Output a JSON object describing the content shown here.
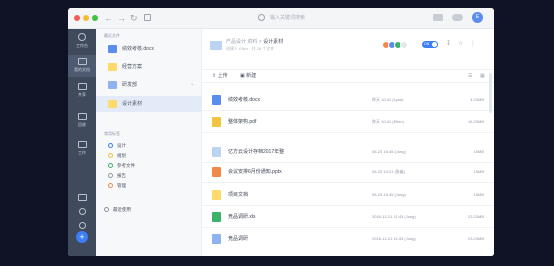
{
  "colors": {
    "accent": "#3d7ef5",
    "rail": "#3f4a5c",
    "folder": "#ffd96a",
    "word": "#5b8def",
    "pdf": "#f0c43f",
    "ppt": "#f08a4b",
    "excel": "#3bb36a",
    "image": "#8fb2f2"
  },
  "search": {
    "placeholder": "输入关键词搜索"
  },
  "user": {
    "initial": "E"
  },
  "rail": {
    "items": [
      {
        "label": "工作台",
        "icon": "dashboard-icon"
      },
      {
        "label": "我的文档",
        "icon": "doc-icon"
      },
      {
        "label": "共享",
        "icon": "share-icon"
      },
      {
        "label": "回收",
        "icon": "trash-icon"
      },
      {
        "label": "工作",
        "icon": "work-icon"
      }
    ]
  },
  "panel": {
    "section_recent": "最近文件",
    "items": [
      {
        "label": "绩效考核.docx",
        "icon": "word-icon"
      },
      {
        "label": "经营方案",
        "icon": "folder-icon"
      },
      {
        "label": "研发部",
        "icon": "team-icon"
      },
      {
        "label": "设计素材",
        "icon": "folder-icon"
      }
    ],
    "section_tags": "常用标签",
    "tags": [
      {
        "label": "设计",
        "color": "#3d7ef5"
      },
      {
        "label": "规划",
        "color": "#f0c43f"
      },
      {
        "label": "参考文件",
        "color": "#3bb36a"
      },
      {
        "label": "报告",
        "color": "#8d95a3"
      },
      {
        "label": "管理",
        "color": "#f08a4b"
      }
    ],
    "recent_use": "最近使用"
  },
  "main": {
    "breadcrumb": {
      "root": "产品设计 资料",
      "sep": ">",
      "current": "设计素材"
    },
    "meta": "创建人 Ellen · 共 28 个文件",
    "toggle": "ON",
    "toolbar": {
      "upload": "上传",
      "new": "新建"
    },
    "files": [
      {
        "name": "绩效考核.docx",
        "date": "昨天 10:41 (Lyon)",
        "size": "4.23MB",
        "type": "word"
      },
      {
        "name": "整体架构.pdf",
        "date": "昨天 10:41 (Ellen)",
        "size": "16.23MB",
        "type": "pdf"
      },
      {
        "name": "亿方云设计存档2017年整",
        "date": "06-23 16:45 (Jung)",
        "size": "15MB",
        "type": "folder"
      },
      {
        "name": "会议安排6月份通知.pptx",
        "date": "06-23 14:21 (张淼)",
        "size": "15MB",
        "type": "ppt"
      },
      {
        "name": "项目文档",
        "date": "06-23 15:45 (Jung)",
        "size": "15MB",
        "type": "folder"
      },
      {
        "name": "竞品调研.xls",
        "date": "2016-12-21 11:43 (Jung)",
        "size": "23.23MB",
        "type": "excel"
      },
      {
        "name": "竞品调研",
        "date": "2016-12-21 11:43 (Jung)",
        "size": "23.23MB",
        "type": "image"
      }
    ]
  }
}
